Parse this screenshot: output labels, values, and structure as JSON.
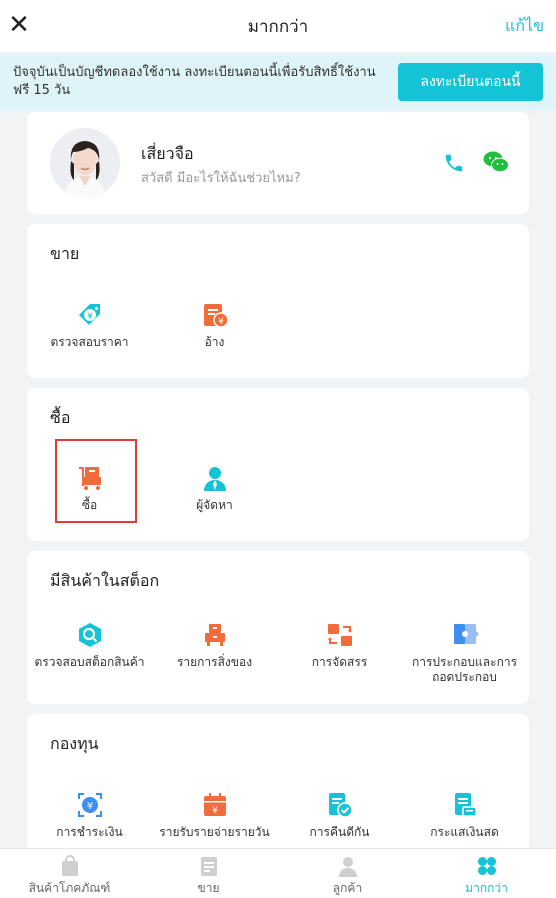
{
  "header": {
    "title": "มากกว่า",
    "edit_label": "แก้ไข",
    "close_icon": "close-icon"
  },
  "banner": {
    "message": "ปัจจุบันเป็นบัญชีทดลองใช้งาน ลงทะเบียนตอนนี้เพื่อรับสิทธิ์ใช้งานฟรี 15 วัน",
    "register_label": "ลงทะเบียนตอนนี้"
  },
  "profile": {
    "name": "เสี่ยวจือ",
    "greeting": "สวัสดี มีอะไรให้ฉันช่วยไหม?",
    "icons": [
      "phone-icon",
      "wechat-icon"
    ]
  },
  "sections": {
    "sale": {
      "title": "ขาย",
      "items": [
        {
          "label": "ตรวจสอบราคา",
          "icon": "price-tag-icon"
        },
        {
          "label": "อ้าง",
          "icon": "quote-icon"
        }
      ]
    },
    "purchase": {
      "title": "ซื้อ",
      "items": [
        {
          "label": "ซื้อ",
          "icon": "purchase-cart-icon"
        },
        {
          "label": "ผู้จัดหา",
          "icon": "supplier-icon"
        }
      ]
    },
    "stock": {
      "title": "มีสินค้าในสต็อก",
      "items": [
        {
          "label": "ตรวจสอบสต็อกสินค้า",
          "icon": "stock-check-icon"
        },
        {
          "label": "รายการสิ่งของ",
          "icon": "item-list-icon"
        },
        {
          "label": "การจัดสรร",
          "icon": "allocation-icon"
        },
        {
          "label": "การประกอบและการถอดประกอบ",
          "icon": "assembly-icon"
        }
      ]
    },
    "fund": {
      "title": "กองทุน",
      "items": [
        {
          "label": "การชำระเงิน",
          "icon": "payment-icon"
        },
        {
          "label": "รายรับรายจ่ายรายวัน",
          "icon": "daily-calendar-icon"
        },
        {
          "label": "การคืนดีกัน",
          "icon": "reconcile-icon"
        },
        {
          "label": "กระแสเงินสด",
          "icon": "cashflow-icon"
        }
      ]
    }
  },
  "tabbar": [
    {
      "label": "สินค้าโภคภัณฑ์",
      "icon": "bag-icon"
    },
    {
      "label": "ขาย",
      "icon": "document-icon"
    },
    {
      "label": "ลูกค้า",
      "icon": "person-icon"
    },
    {
      "label": "มากกว่า",
      "icon": "clover-icon",
      "active": true
    }
  ],
  "colors": {
    "accent": "#14c3d6",
    "orange": "#f26b3a",
    "blue": "#3d8ef0",
    "banner_bg": "#dff4f8",
    "highlight": "#e03a3a"
  }
}
